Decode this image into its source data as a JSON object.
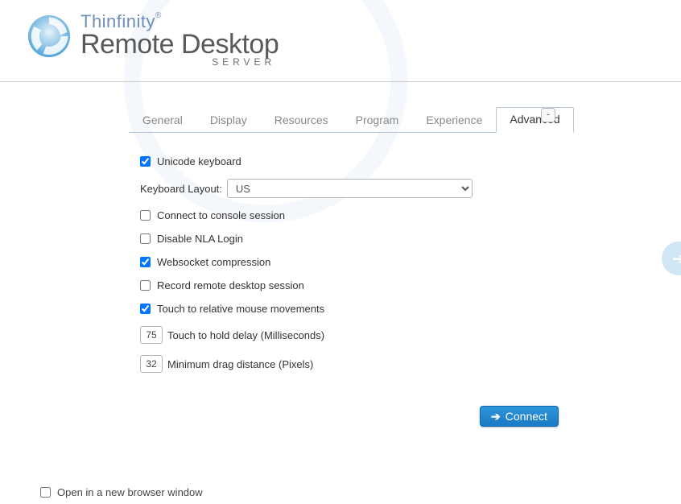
{
  "brand": {
    "line1": "Thinfinity",
    "reg": "®",
    "line2": "Remote Desktop",
    "line3": "SERVER"
  },
  "tabs": {
    "general": "General",
    "display": "Display",
    "resources": "Resources",
    "program": "Program",
    "experience": "Experience",
    "advanced": "Advanced"
  },
  "collapse_label": "-",
  "form": {
    "unicode_keyboard": {
      "label": "Unicode keyboard",
      "checked": true
    },
    "keyboard_layout": {
      "label": "Keyboard Layout:",
      "value": "US"
    },
    "connect_console": {
      "label": "Connect to console session",
      "checked": false
    },
    "disable_nla": {
      "label": "Disable NLA Login",
      "checked": false
    },
    "websocket_compression": {
      "label": "Websocket compression",
      "checked": true
    },
    "record_session": {
      "label": "Record remote desktop session",
      "checked": false
    },
    "touch_relative": {
      "label": "Touch to relative mouse movements",
      "checked": true
    },
    "touch_hold_delay": {
      "label": "Touch to hold delay (Milliseconds)",
      "value": "75"
    },
    "min_drag_distance": {
      "label": "Minimum drag distance (Pixels)",
      "value": "32"
    }
  },
  "connect_label": "Connect",
  "footer": {
    "open_new_window": {
      "label": "Open in a new browser window",
      "checked": false
    }
  }
}
